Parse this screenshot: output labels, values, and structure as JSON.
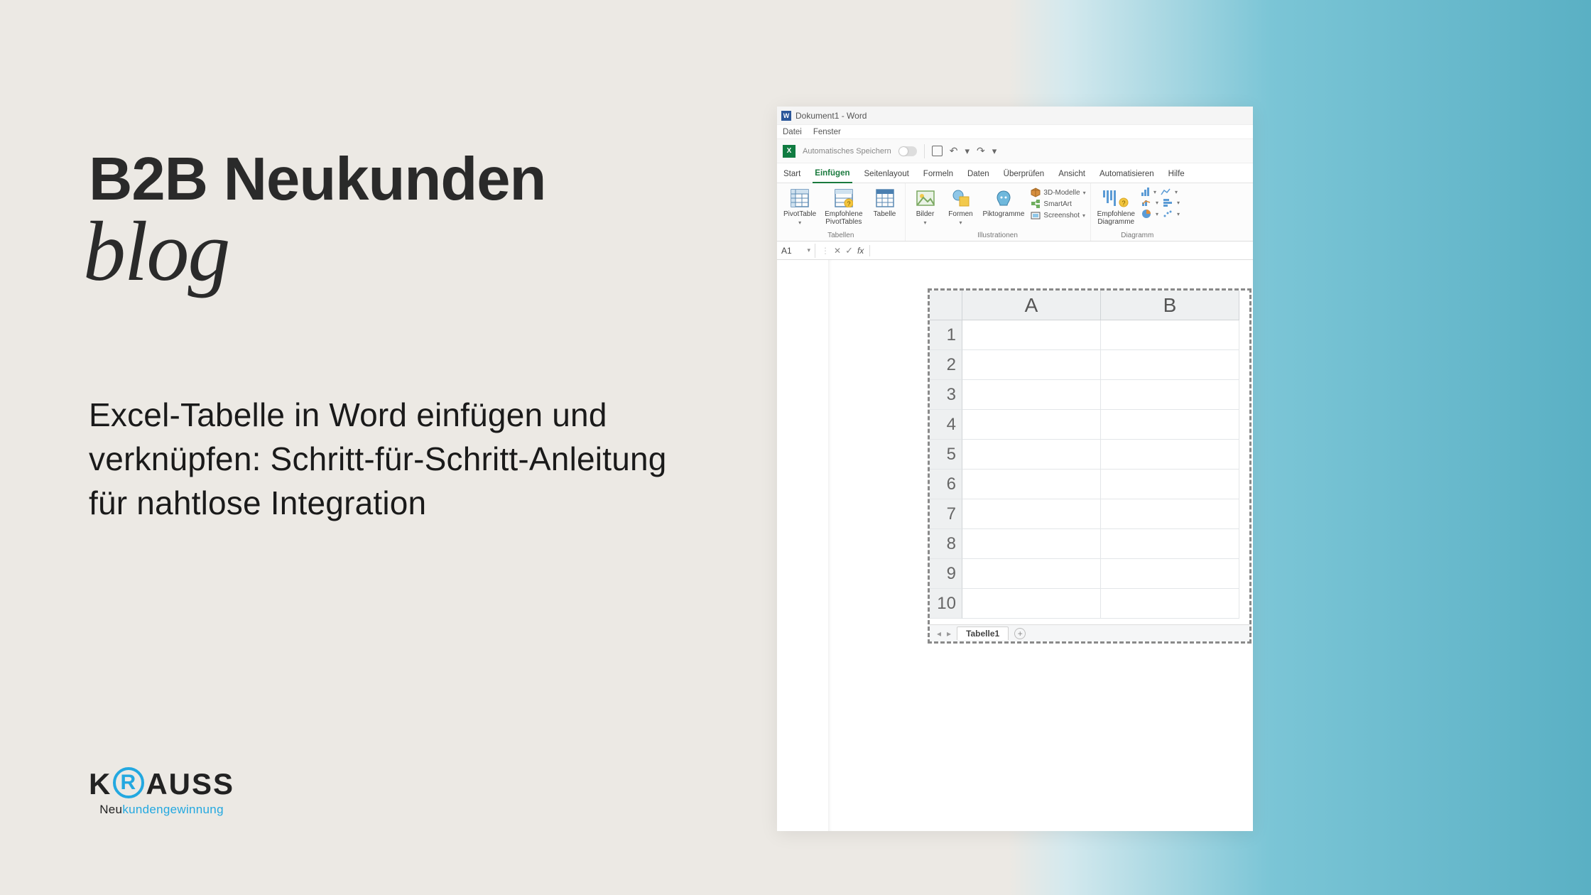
{
  "page": {
    "headline": "B2B Neukunden",
    "blog_word": "blog",
    "subtitle": "Excel-Tabelle in Word einfügen und verknüpfen: Schritt-für-Schritt-Anleitung für nahtlose Integration"
  },
  "logo": {
    "text_prefix": "K",
    "text_r": "R",
    "text_suffix": "AUSS",
    "sub_prefix": "Neu",
    "sub_accent": "kundengewinnung"
  },
  "word": {
    "title": "Dokument1 - Word",
    "menu": {
      "datei": "Datei",
      "fenster": "Fenster"
    },
    "qat": {
      "autosave_label": "Automatisches Speichern"
    },
    "tabs": {
      "start": "Start",
      "einfuegen": "Einfügen",
      "seitenlayout": "Seitenlayout",
      "formeln": "Formeln",
      "daten": "Daten",
      "ueberpruefen": "Überprüfen",
      "ansicht": "Ansicht",
      "automatisieren": "Automatisieren",
      "hilfe": "Hilfe"
    },
    "ribbon": {
      "pivottable": "PivotTable",
      "empf_pivots": "Empfohlene\nPivotTables",
      "tabelle": "Tabelle",
      "group_tabellen": "Tabellen",
      "bilder": "Bilder",
      "formen": "Formen",
      "piktogramme": "Piktogramme",
      "models3d": "3D-Modelle",
      "smartart": "SmartArt",
      "screenshot": "Screenshot",
      "group_illustrationen": "Illustrationen",
      "empf_diag": "Empfohlene\nDiagramme",
      "group_diagramme": "Diagramm"
    },
    "formula": {
      "name_box": "A1",
      "fx": "fx"
    },
    "sheet": {
      "cols": [
        "A",
        "B"
      ],
      "rows": [
        "1",
        "2",
        "3",
        "4",
        "5",
        "6",
        "7",
        "8",
        "9",
        "10"
      ],
      "tab": "Tabelle1"
    }
  }
}
